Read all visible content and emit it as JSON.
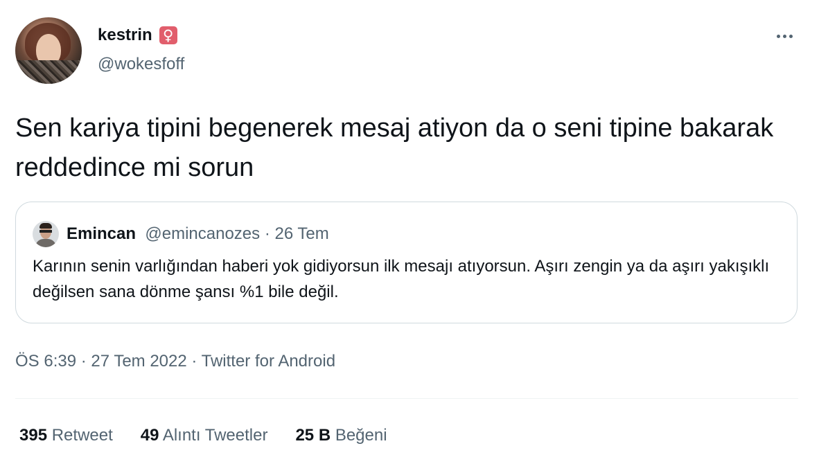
{
  "author": {
    "display_name": "kestrin",
    "badge_glyph": "♀",
    "handle": "@wokesfoff"
  },
  "tweet": {
    "text": "Sen kariya tipini begenerek mesaj atiyon da o seni tipine bakarak reddedince mi sorun"
  },
  "quote": {
    "name": "Emincan",
    "handle": "@emincanozes",
    "separator": " · ",
    "date": "26 Tem",
    "text": "Karının senin varlığından haberi yok gidiyorsun ilk mesajı atıyorsun. Aşırı zengin ya da aşırı yakışıklı değilsen sana dönme şansı %1 bile değil."
  },
  "meta": {
    "time": "ÖS 6:39",
    "separator": " · ",
    "date": "27 Tem 2022",
    "source": "Twitter for Android"
  },
  "stats": [
    {
      "count": "395",
      "label": "Retweet"
    },
    {
      "count": "49",
      "label": "Alıntı Tweetler"
    },
    {
      "count": "25 B",
      "label": "Beğeni"
    }
  ],
  "colors": {
    "text_primary": "#0f1419",
    "text_secondary": "#536471",
    "border": "#cfd9de",
    "badge_bg": "#e15e6c"
  },
  "icons": {
    "more": "more-horizontal-icon",
    "badge": "female-sign-icon"
  }
}
